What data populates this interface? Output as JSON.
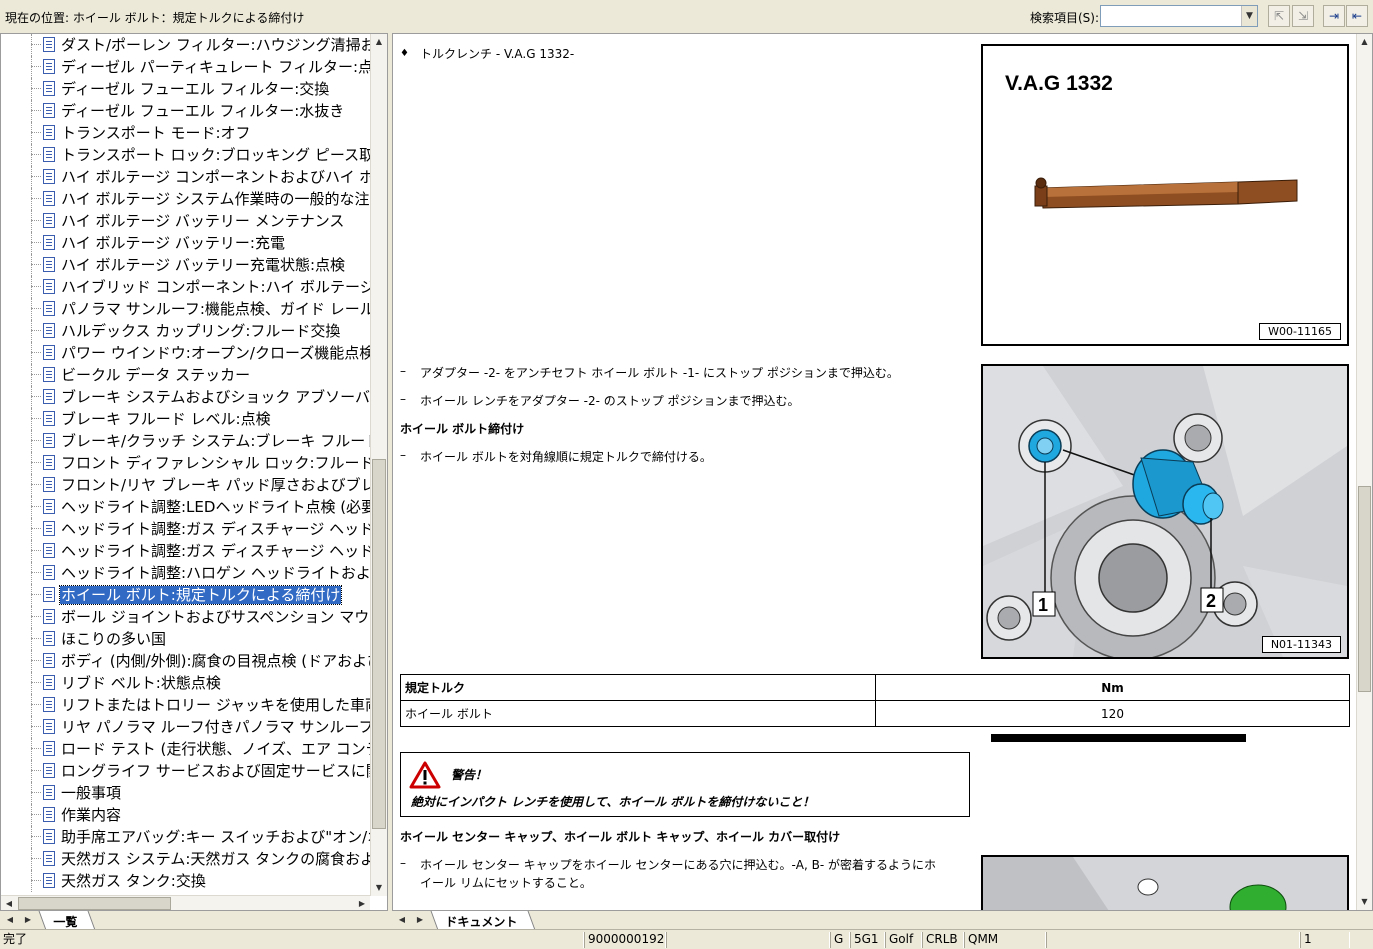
{
  "toolbar": {
    "location_label": "現在の位置: ホイール ボルト：規定トルクによる締付け",
    "search_label": "検索項目(S):",
    "search_value": ""
  },
  "tree": {
    "items": [
      "ダスト/ポーレン フィルター:ハウジング清掃およびフ",
      "ディーゼル パーティキュレート フィルター:点検",
      "ディーゼル フューエル フィルター:交換",
      "ディーゼル フューエル フィルター:水抜き",
      "トランスポート モード:オフ",
      "トランスポート ロック:ブロッキング ピース取外し",
      "ハイ ボルテージ コンポーネントおよびハイ ボルテ",
      "ハイ ボルテージ システム作業時の一般的な注意",
      "ハイ ボルテージ バッテリー メンテナンス",
      "ハイ ボルテージ バッテリー:充電",
      "ハイ ボルテージ バッテリー充電状態:点検",
      "ハイブリッド コンポーネント:ハイ ボルテージ コンポ",
      "パノラマ サンルーフ:機能点検、ガイド レール清掃",
      "ハルデックス カップリング:フルード交換",
      "パワー ウインドウ:オープン/クローズ機能点検",
      "ビークル データ ステッカー",
      "ブレーキ システムおよびショック アブソーバー:リーク",
      "ブレーキ フルード レベル:点検",
      "ブレーキ/クラッチ システム:ブレーキ フルード交換",
      "フロント ディファレンシャル ロック:フルード交換",
      "フロント/リヤ ブレーキ パッド厚さおよびブレーキ ディ",
      "ヘッドライト調整:LEDヘッドライト点検 (必要に応じ",
      "ヘッドライト調整:ガス ディスチャージ ヘッドライト",
      "ヘッドライト調整:ガス ディスチャージ ヘッドライト",
      "ヘッドライト調整:ハロゲン ヘッドライトおよびフォグ",
      "ホイール ボルト:規定トルクによる締付け",
      "ボール ジョイントおよびサスペンション マウント:目視",
      "ほこりの多い国",
      "ボディ (内側/外側):腐食の目視点検 (ドアおよび",
      "リブド ベルト:状態点検",
      "リフトまたはトロリー ジャッキを使用した車両リフト",
      "リヤ パノラマ ルーフ付きパノラマ サンルーフ:機能",
      "ロード テスト (走行状態、ノイズ、エア コンディショ",
      "ロングライフ サービスおよび固定サービスに関する",
      "一般事項",
      "作業内容",
      "助手席エアバッグ:キー スイッチおよび\"オン/オフ\"",
      "天然ガス システム:天然ガス タンクの腐食および",
      "天然ガス タンク:交換"
    ],
    "selected_index": 25
  },
  "left_tab": "一覧",
  "right_tab": "ドキュメント",
  "content": {
    "tool_line": "トルクレンチ - V.A.G 1332-",
    "tool_fig_title": "V.A.G 1332",
    "tool_fig_code": "W00-11165",
    "step1": "アダプター -2- をアンチセフト ホイール ボルト -1- にストップ ポジションまで押込む。",
    "step2": "ホイール レンチをアダプター -2- のストップ ポジションまで押込む。",
    "heading1": "ホイール ボルト締付け",
    "step3": "ホイール ボルトを対角線順に規定トルクで締付ける。",
    "wheel_fig_code": "N01-11343",
    "callout1": "1",
    "callout2": "2",
    "dash": "–",
    "bullet": "♦",
    "table": {
      "header_left": "規定トルク",
      "header_right": "Nm",
      "row_left": "ホイール ボルト",
      "row_right": "120"
    },
    "warning_title": "警告！",
    "warning_text": "絶対にインパクト レンチを使用して、ホイール ボルトを締付けないこと！",
    "heading2": "ホイール センター キャップ、ホイール ボルト キャップ、ホイール カバー取付け",
    "step4_line1": "ホイール センター キャップをホイール センターにある穴に押込む。-A, B- が密着するようにホ",
    "step4_line2": "イール リムにセットすること。"
  },
  "status": {
    "state": "完了",
    "doc_id": "9000000192",
    "c1": "G",
    "c2": "5G1",
    "c3": "Golf",
    "c4": "CRLB",
    "c5": "QMM",
    "page": "1"
  }
}
